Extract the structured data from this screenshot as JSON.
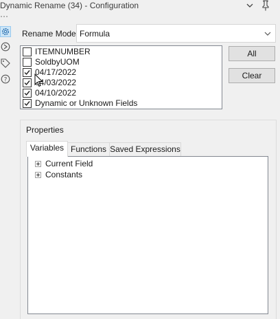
{
  "window": {
    "title": "Dynamic Rename (34) - Configuration"
  },
  "side_icons": [
    "gear-icon",
    "connection-icon",
    "tag-icon",
    "help-icon"
  ],
  "rename_mode": {
    "label": "Rename Mode:",
    "value": "Formula"
  },
  "fields": [
    {
      "label": "ITEMNUMBER",
      "checked": false
    },
    {
      "label": "SoldbyUOM",
      "checked": false
    },
    {
      "label": "04/17/2022",
      "checked": true
    },
    {
      "label": "04/03/2022",
      "checked": true
    },
    {
      "label": "04/10/2022",
      "checked": true
    },
    {
      "label": "Dynamic or Unknown Fields",
      "checked": true
    }
  ],
  "buttons": {
    "all": "All",
    "clear": "Clear"
  },
  "properties": {
    "label": "Properties",
    "tabs": [
      {
        "label": "Variables",
        "active": true
      },
      {
        "label": "Functions",
        "active": false
      },
      {
        "label": "Saved Expressions",
        "active": false
      }
    ],
    "tree": [
      {
        "label": "Current Field"
      },
      {
        "label": "Constants"
      }
    ]
  },
  "colors": {
    "background": "#f0f0f0",
    "selected_icon_bg": "#cde6f7",
    "button_bg": "#e1e1e1"
  }
}
